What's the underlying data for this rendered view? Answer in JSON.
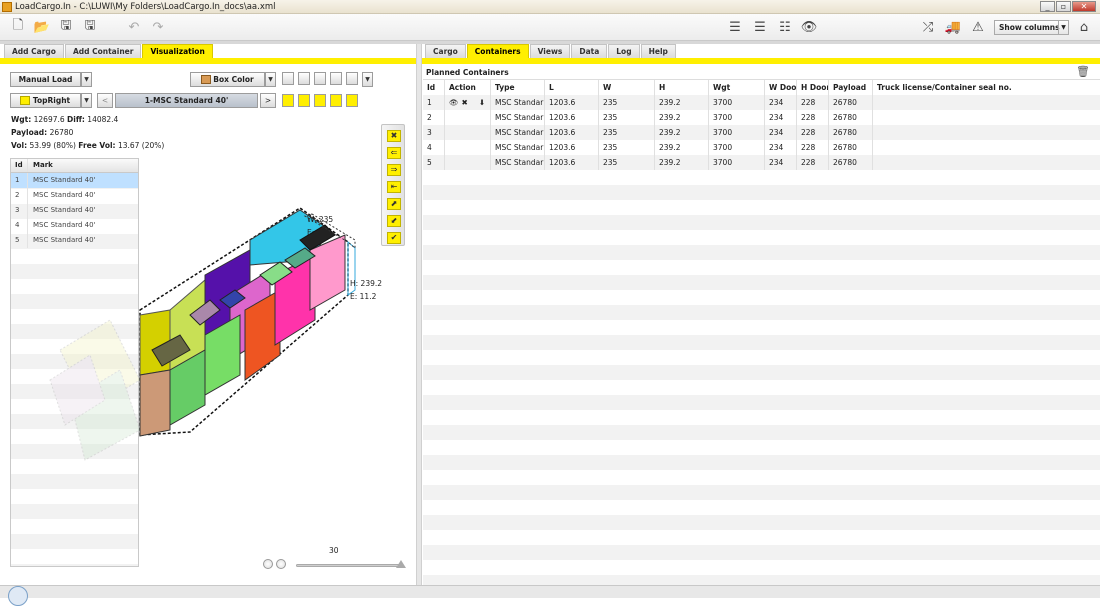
{
  "window": {
    "title": "LoadCargo.In - C:\\LUWI\\My Folders\\LoadCargo.In_docs\\aa.xml"
  },
  "toolbar": {
    "show_columns_label": "Show columns"
  },
  "left_tabs": [
    {
      "label": "Add Cargo"
    },
    {
      "label": "Add Container"
    },
    {
      "label": "Visualization",
      "active": true
    }
  ],
  "right_tabs": [
    {
      "label": "Cargo"
    },
    {
      "label": "Containers",
      "active": true
    },
    {
      "label": "Views"
    },
    {
      "label": "Data"
    },
    {
      "label": "Log"
    },
    {
      "label": "Help"
    }
  ],
  "viz": {
    "load_mode": "Manual Load",
    "color_mode": "Box Color",
    "view_mode": "TopRight",
    "container_selector": "1-MSC Standard 40'",
    "prev_label": "<",
    "next_label": ">",
    "wgt_label": "Wgt:",
    "wgt_value": "12697.6",
    "diff_label": "Diff:",
    "diff_value": "14082.4",
    "payload_label": "Payload:",
    "payload_value": "26780",
    "vol_label": "Vol:",
    "vol_value": "53.99 (80%)",
    "freevol_label": "Free Vol:",
    "freevol_value": "13.67 (20%)",
    "dim_w": "W: 235",
    "dim_e_top": "E:",
    "dim_h": "H: 239.2",
    "dim_e": "E: 11.2",
    "zoom_value": "30"
  },
  "mark_grid": {
    "headers": {
      "id": "Id",
      "mark": "Mark"
    },
    "rows": [
      {
        "id": "1",
        "mark": "MSC Standard 40'"
      },
      {
        "id": "2",
        "mark": "MSC Standard 40'"
      },
      {
        "id": "3",
        "mark": "MSC Standard 40'"
      },
      {
        "id": "4",
        "mark": "MSC Standard 40'"
      },
      {
        "id": "5",
        "mark": "MSC Standard 40'"
      }
    ]
  },
  "planned": {
    "title": "Planned Containers",
    "headers": [
      "Id",
      "Action",
      "Type",
      "L",
      "W",
      "H",
      "Wgt",
      "W Doo",
      "H Door",
      "Payload",
      "Truck license/Container seal no."
    ],
    "rows": [
      [
        "1",
        "",
        "MSC Standar",
        "1203.6",
        "235",
        "239.2",
        "3700",
        "234",
        "228",
        "26780",
        ""
      ],
      [
        "2",
        "",
        "MSC Standar",
        "1203.6",
        "235",
        "239.2",
        "3700",
        "234",
        "228",
        "26780",
        ""
      ],
      [
        "3",
        "",
        "MSC Standar",
        "1203.6",
        "235",
        "239.2",
        "3700",
        "234",
        "228",
        "26780",
        ""
      ],
      [
        "4",
        "",
        "MSC Standar",
        "1203.6",
        "235",
        "239.2",
        "3700",
        "234",
        "228",
        "26780",
        ""
      ],
      [
        "5",
        "",
        "MSC Standar",
        "1203.6",
        "235",
        "239.2",
        "3700",
        "234",
        "228",
        "26780",
        ""
      ]
    ]
  },
  "colors": {
    "accent": "#ffef00",
    "selection": "#bfe0ff"
  }
}
